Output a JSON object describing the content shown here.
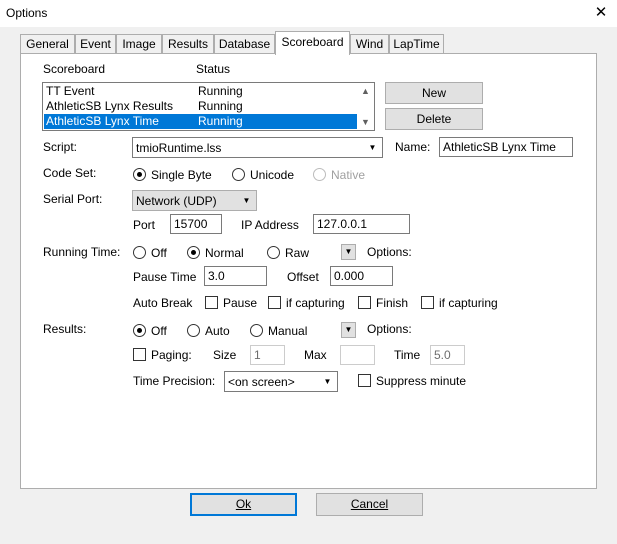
{
  "window": {
    "title": "Options",
    "close_glyph": "✕"
  },
  "tabs": [
    {
      "label": "General"
    },
    {
      "label": "Event"
    },
    {
      "label": "Image"
    },
    {
      "label": "Results"
    },
    {
      "label": "Database"
    },
    {
      "label": "Scoreboard",
      "active": true
    },
    {
      "label": "Wind"
    },
    {
      "label": "LapTime"
    }
  ],
  "scoreboards": {
    "col_scoreboard": "Scoreboard",
    "col_status": "Status",
    "rows": [
      {
        "name": "TT Event",
        "status": "Running"
      },
      {
        "name": "AthleticSB Lynx Results",
        "status": "Running"
      },
      {
        "name": "AthleticSB Lynx Time",
        "status": "Running",
        "selected": true
      }
    ],
    "new_label": "New",
    "delete_label": "Delete"
  },
  "script": {
    "label": "Script:",
    "value": "tmioRuntime.lss"
  },
  "name": {
    "label": "Name:",
    "value": "AthleticSB Lynx Time"
  },
  "code_set": {
    "label": "Code Set:",
    "options": [
      "Single Byte",
      "Unicode",
      "Native"
    ],
    "selected": "Single Byte",
    "disabled": [
      "Native"
    ]
  },
  "serial_port": {
    "label": "Serial Port:",
    "value": "Network (UDP)",
    "port_label": "Port",
    "port_value": "15700",
    "ip_label": "IP Address",
    "ip_value": "127.0.0.1"
  },
  "running_time": {
    "label": "Running Time:",
    "options": [
      "Off",
      "Normal",
      "Raw"
    ],
    "selected": "Normal",
    "options_label": "Options:",
    "pause_time_label": "Pause Time",
    "pause_time_value": "3.0",
    "offset_label": "Offset",
    "offset_value": "0.000",
    "auto_break_label": "Auto Break",
    "pause_check_label": "Pause",
    "if_capturing_1": "if capturing",
    "finish_check_label": "Finish",
    "if_capturing_2": "if capturing"
  },
  "results": {
    "label": "Results:",
    "options": [
      "Off",
      "Auto",
      "Manual"
    ],
    "selected": "Off",
    "options_label": "Options:",
    "paging_label": "Paging:",
    "size_label": "Size",
    "size_value": "1",
    "max_label": "Max",
    "max_value": "",
    "time_label": "Time",
    "time_value": "5.0",
    "time_precision_label": "Time Precision:",
    "time_precision_value": "<on screen>",
    "suppress_minute_label": "Suppress minute"
  },
  "footer": {
    "ok_label": "Ok",
    "cancel_label": "Cancel"
  },
  "colors": {
    "selection": "#0078d7",
    "face": "#f0f0f0",
    "panel": "#ffffff",
    "border": "#adadad"
  },
  "icons": {
    "close": "close-icon",
    "dropdown": "chevron-down-icon",
    "scroll_up": "scroll-up-icon",
    "scroll_down": "scroll-down-icon"
  }
}
